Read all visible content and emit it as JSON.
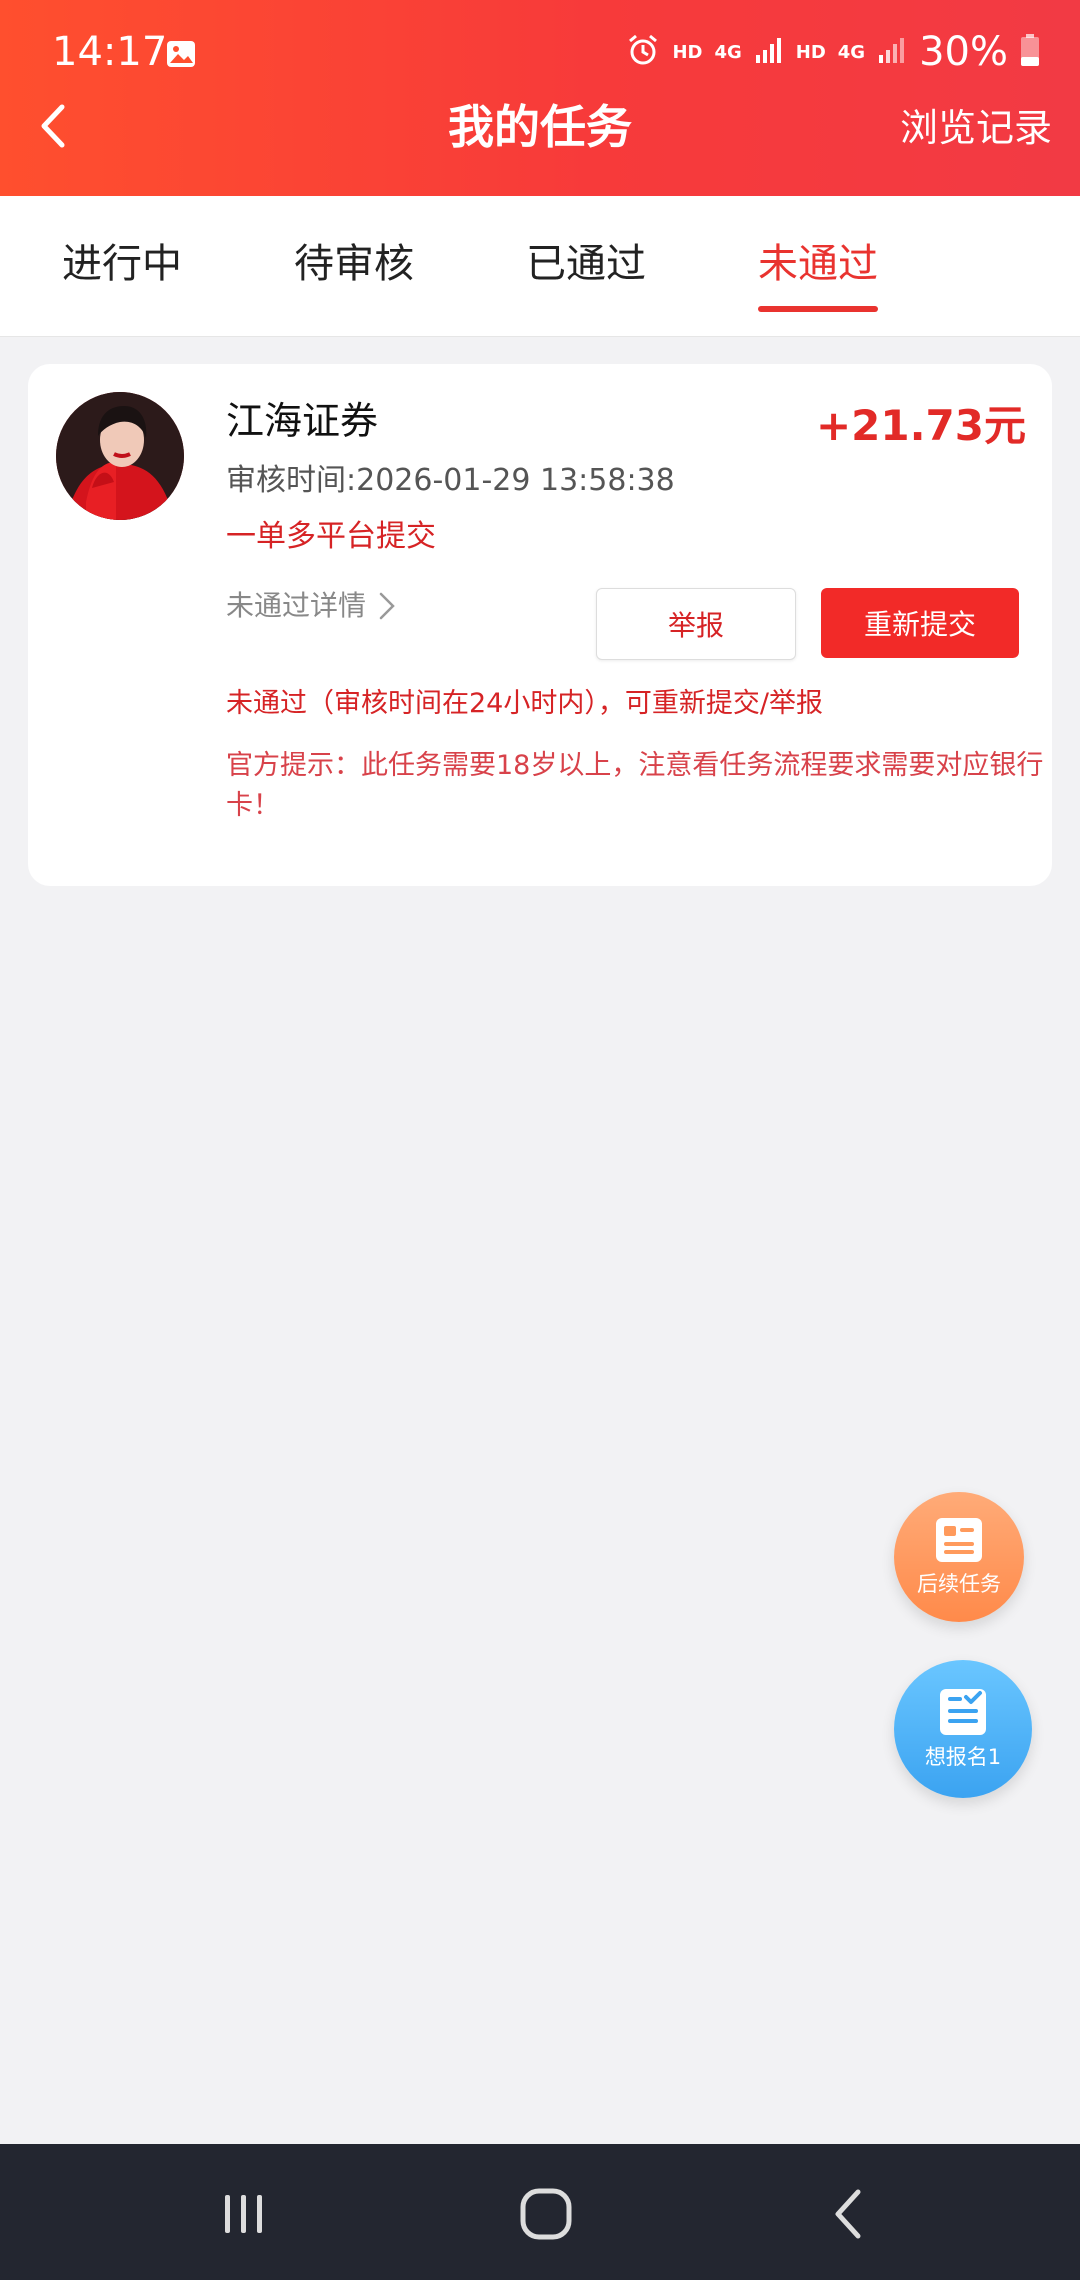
{
  "status_bar": {
    "time": "14:17",
    "network_labels": [
      "HD",
      "4G",
      "HD",
      "4G"
    ],
    "battery": "30%"
  },
  "header": {
    "title": "我的任务",
    "right_link": "浏览记录"
  },
  "tabs": [
    {
      "label": "进行中",
      "active": false
    },
    {
      "label": "待审核",
      "active": false
    },
    {
      "label": "已通过",
      "active": false
    },
    {
      "label": "未通过",
      "active": true
    }
  ],
  "task": {
    "company": "江海证券",
    "reward": "+21.73元",
    "review_time": "审核时间:2026-01-29 13:58:38",
    "tag": "一单多平台提交",
    "fail_detail_label": "未通过详情",
    "report_label": "举报",
    "resubmit_label": "重新提交",
    "notice": "未通过（审核时间在24小时内），可重新提交/举报",
    "official_tip": "官方提示：此任务需要18岁以上，注意看任务流程要求需要对应银行卡！"
  },
  "floating": {
    "followup_label": "后续任务",
    "enroll_label": "想报名1"
  },
  "colors": {
    "brand_red": "#f23a3a",
    "accent_red": "#e22a27",
    "followup_orange": "#ff8a4a",
    "enroll_blue": "#3ba3f1"
  }
}
